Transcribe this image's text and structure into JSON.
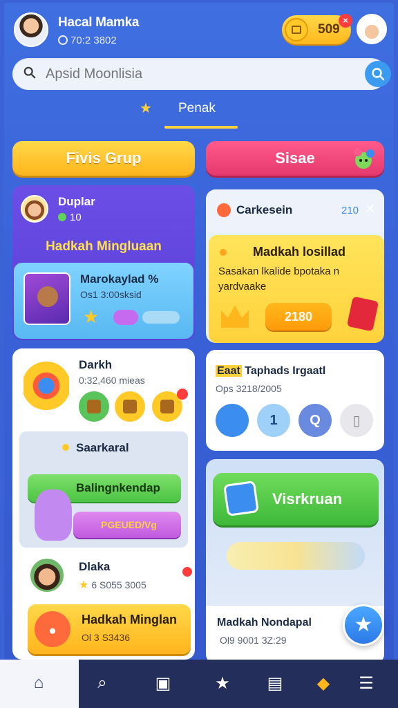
{
  "header": {
    "user_name": "Hacal Mamka",
    "user_sub": "70:2 3802",
    "coins": "509",
    "coin_badge": "×"
  },
  "search": {
    "placeholder": "Apsid Moonlisia"
  },
  "tab": {
    "label": "Penak"
  },
  "buttons": {
    "yellow": "Fivis Grup",
    "pink": "Sisae"
  },
  "player_card": {
    "name": "Duplar",
    "score": "10",
    "title": "Hadkah Mingluaan",
    "inner_title": "Marokaylad",
    "inner_percent": "%",
    "inner_sub": "Os1 3:00sksid"
  },
  "notification": {
    "title": "Carkesein",
    "count": "210",
    "close": "✕",
    "body_title": "Madkah losillad",
    "body_text": "Sasakan lkalide bpotaka n yardvaake",
    "button": "2180"
  },
  "game_card": {
    "title": "Darkh",
    "sub": "0:32,460 mieas",
    "section_title": "Saarkaral",
    "green_button": "Balingnkendap",
    "purple_button": "PGEUED/Vg",
    "friend_name": "Dlaka",
    "friend_sub": "6 S055 3005",
    "cta_title": "Hadkah Minglan",
    "cta_sub": "Ol 3 S3436"
  },
  "right_card": {
    "title_highlight": "Eaat",
    "title": "Taphads Irgaatl",
    "sub": "Ops 3218/2005",
    "icon2": "1",
    "icon3": "Q",
    "icon4": "▯"
  },
  "lower_right": {
    "button": "Visrkruan",
    "strip_title": "Madkah Nondapal",
    "strip_sub": "Ol9 9001 3Z:29"
  },
  "nav": {
    "home": "⌂",
    "search": "⌕",
    "games": "▣",
    "star": "★",
    "bag": "▤",
    "chest": "◆",
    "menu": "☰"
  }
}
